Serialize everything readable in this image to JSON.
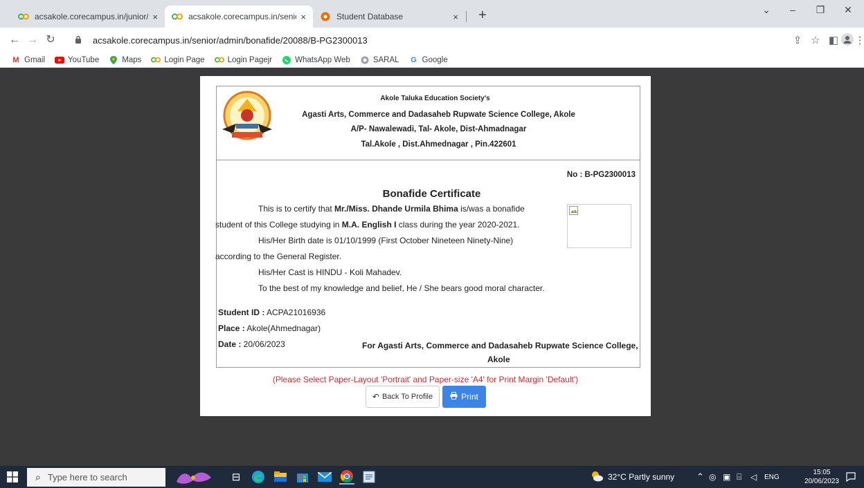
{
  "browser": {
    "tabs": [
      {
        "title": "acsakole.corecampus.in/junior/ac",
        "active": false
      },
      {
        "title": "acsakole.corecampus.in/senior/ac",
        "active": true
      },
      {
        "title": "Student Database",
        "active": false
      }
    ],
    "close_glyph": "×",
    "new_tab_glyph": "+",
    "url": "acsakole.corecampus.in/senior/admin/bonafide/20088/B-PG2300013",
    "bookmarks": [
      {
        "label": "Gmail",
        "icon": "gmail-icon"
      },
      {
        "label": "YouTube",
        "icon": "youtube-icon"
      },
      {
        "label": "Maps",
        "icon": "maps-icon"
      },
      {
        "label": "Login Page",
        "icon": "corecampus-icon"
      },
      {
        "label": "Login Pagejr",
        "icon": "corecampus-icon"
      },
      {
        "label": "WhatsApp Web",
        "icon": "whatsapp-icon"
      },
      {
        "label": "SARAL",
        "icon": "saral-icon"
      },
      {
        "label": "Google",
        "icon": "google-icon"
      }
    ]
  },
  "certificate": {
    "society": "Akole Taluka Education Society's",
    "college": "Agasti Arts, Commerce and Dadasaheb Rupwate Science College, Akole",
    "address": "A/P- Nawalewadi, Tal- Akole, Dist-Ahmadnagar",
    "pin": "Tal.Akole , Dist.Ahmednagar , Pin.422601",
    "number": "No : B-PG2300013",
    "title": "Bonafide Certificate",
    "p1_pre": "This is to certify that ",
    "student_name": "Mr./Miss. Dhande Urmila Bhima",
    "p1_post": " is/was a bonafide",
    "p2_pre": "student of this College studying in ",
    "course": "M.A. English I",
    "p2_post": " class during the year 2020-2021.",
    "birth_line": "His/Her Birth date is 01/10/1999 (First October Nineteen Ninety-Nine)",
    "register_line": "according to the General Register.",
    "cast_line": "His/Her Cast is HINDU - Koli Mahadev.",
    "character_line": "To the best of my knowledge and belief, He / She bears good moral character.",
    "student_id_label": "Student ID :",
    "student_id": " ACPA21016936",
    "place_label": "Place :",
    "place": " Akole(Ahmednagar)",
    "date_label": "Date :",
    "date": " 20/06/2023",
    "sign_line1": "For Agasti Arts, Commerce and Dadasaheb Rupwate Science College,",
    "sign_line2": "Akole"
  },
  "page": {
    "print_note": "(Please Select Paper-Layout 'Portrait' and Paper-size 'A4' for Print Margin 'Default')",
    "back_label": "Back To Profile",
    "print_label": "Print"
  },
  "taskbar": {
    "search_placeholder": "Type here to search",
    "weather": "32°C  Partly sunny",
    "lang": "ENG",
    "time": "15:05",
    "date": "20/06/2023"
  },
  "colors": {
    "print_button": "#3c84e6",
    "note_red": "#e0262b",
    "page_background": "#3a3a3a"
  }
}
